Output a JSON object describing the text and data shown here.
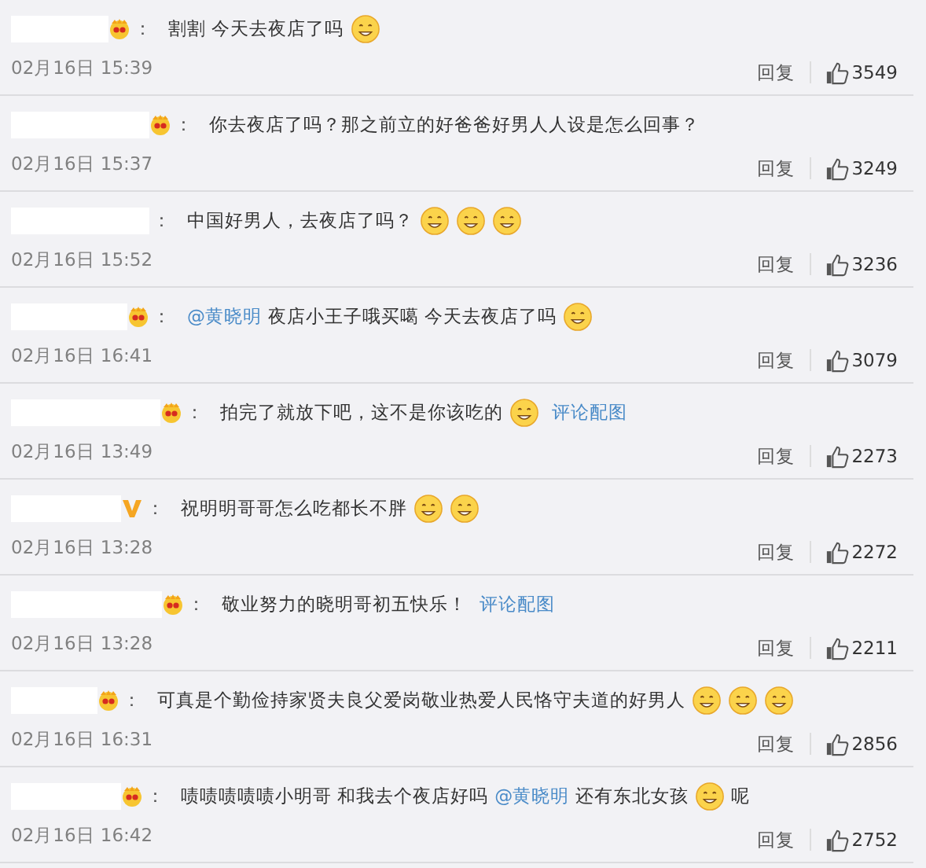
{
  "comments": [
    {
      "badge": {
        "kind": "crown"
      },
      "separator": "：",
      "content": [
        {
          "kind": "text",
          "text": "割割 今天去夜店了吗"
        },
        {
          "kind": "emoji"
        }
      ],
      "time": "02月16日 15:39",
      "reply": "回复",
      "likes": "3549"
    },
    {
      "badge": {
        "kind": "crown"
      },
      "separator": "：",
      "content": [
        {
          "kind": "text",
          "text": "你去夜店了吗？那之前立的好爸爸好男人人设是怎么回事？"
        }
      ],
      "time": "02月16日 15:37",
      "reply": "回复",
      "likes": "3249"
    },
    {
      "badge": {
        "kind": "none"
      },
      "separator": "：",
      "content": [
        {
          "kind": "text",
          "text": "中国好男人，去夜店了吗？"
        },
        {
          "kind": "emoji"
        },
        {
          "kind": "emoji"
        },
        {
          "kind": "emoji"
        }
      ],
      "time": "02月16日 15:52",
      "reply": "回复",
      "likes": "3236"
    },
    {
      "badge": {
        "kind": "crown"
      },
      "separator": "：",
      "content": [
        {
          "kind": "mention",
          "text": "@黄晓明"
        },
        {
          "kind": "text",
          "text": "夜店小王子哦买噶 今天去夜店了吗"
        },
        {
          "kind": "emoji"
        }
      ],
      "time": "02月16日 16:41",
      "reply": "回复",
      "likes": "3079"
    },
    {
      "badge": {
        "kind": "crown"
      },
      "separator": "：",
      "content": [
        {
          "kind": "text",
          "text": "拍完了就放下吧，这不是你该吃的"
        },
        {
          "kind": "emoji"
        },
        {
          "kind": "link",
          "text": "评论配图"
        }
      ],
      "time": "02月16日 13:49",
      "reply": "回复",
      "likes": "2273"
    },
    {
      "badge": {
        "kind": "verified"
      },
      "separator": "：",
      "content": [
        {
          "kind": "text",
          "text": "祝明明哥哥怎么吃都长不胖"
        },
        {
          "kind": "emoji"
        },
        {
          "kind": "emoji"
        }
      ],
      "time": "02月16日 13:28",
      "reply": "回复",
      "likes": "2272"
    },
    {
      "badge": {
        "kind": "crown"
      },
      "separator": "：",
      "content": [
        {
          "kind": "text",
          "text": "敬业努力的晓明哥初五快乐！"
        },
        {
          "kind": "link",
          "text": "评论配图"
        }
      ],
      "time": "02月16日 13:28",
      "reply": "回复",
      "likes": "2211"
    },
    {
      "badge": {
        "kind": "crown"
      },
      "separator": "：",
      "content": [
        {
          "kind": "text",
          "text": "可真是个勤俭持家贤夫良父爱岗敬业热爱人民恪守夫道的好男人"
        },
        {
          "kind": "emoji"
        },
        {
          "kind": "emoji"
        },
        {
          "kind": "emoji"
        }
      ],
      "time": "02月16日 16:31",
      "reply": "回复",
      "likes": "2856"
    },
    {
      "badge": {
        "kind": "crown"
      },
      "separator": "：",
      "content": [
        {
          "kind": "text",
          "text": "啧啧啧啧啧小明哥 和我去个夜店好吗"
        },
        {
          "kind": "mention",
          "text": "@黄晓明"
        },
        {
          "kind": "text",
          "text": "还有东北女孩"
        },
        {
          "kind": "emoji"
        },
        {
          "kind": "text",
          "text": "呢"
        }
      ],
      "time": "02月16日 16:42",
      "reply": "回复",
      "likes": "2752"
    }
  ]
}
